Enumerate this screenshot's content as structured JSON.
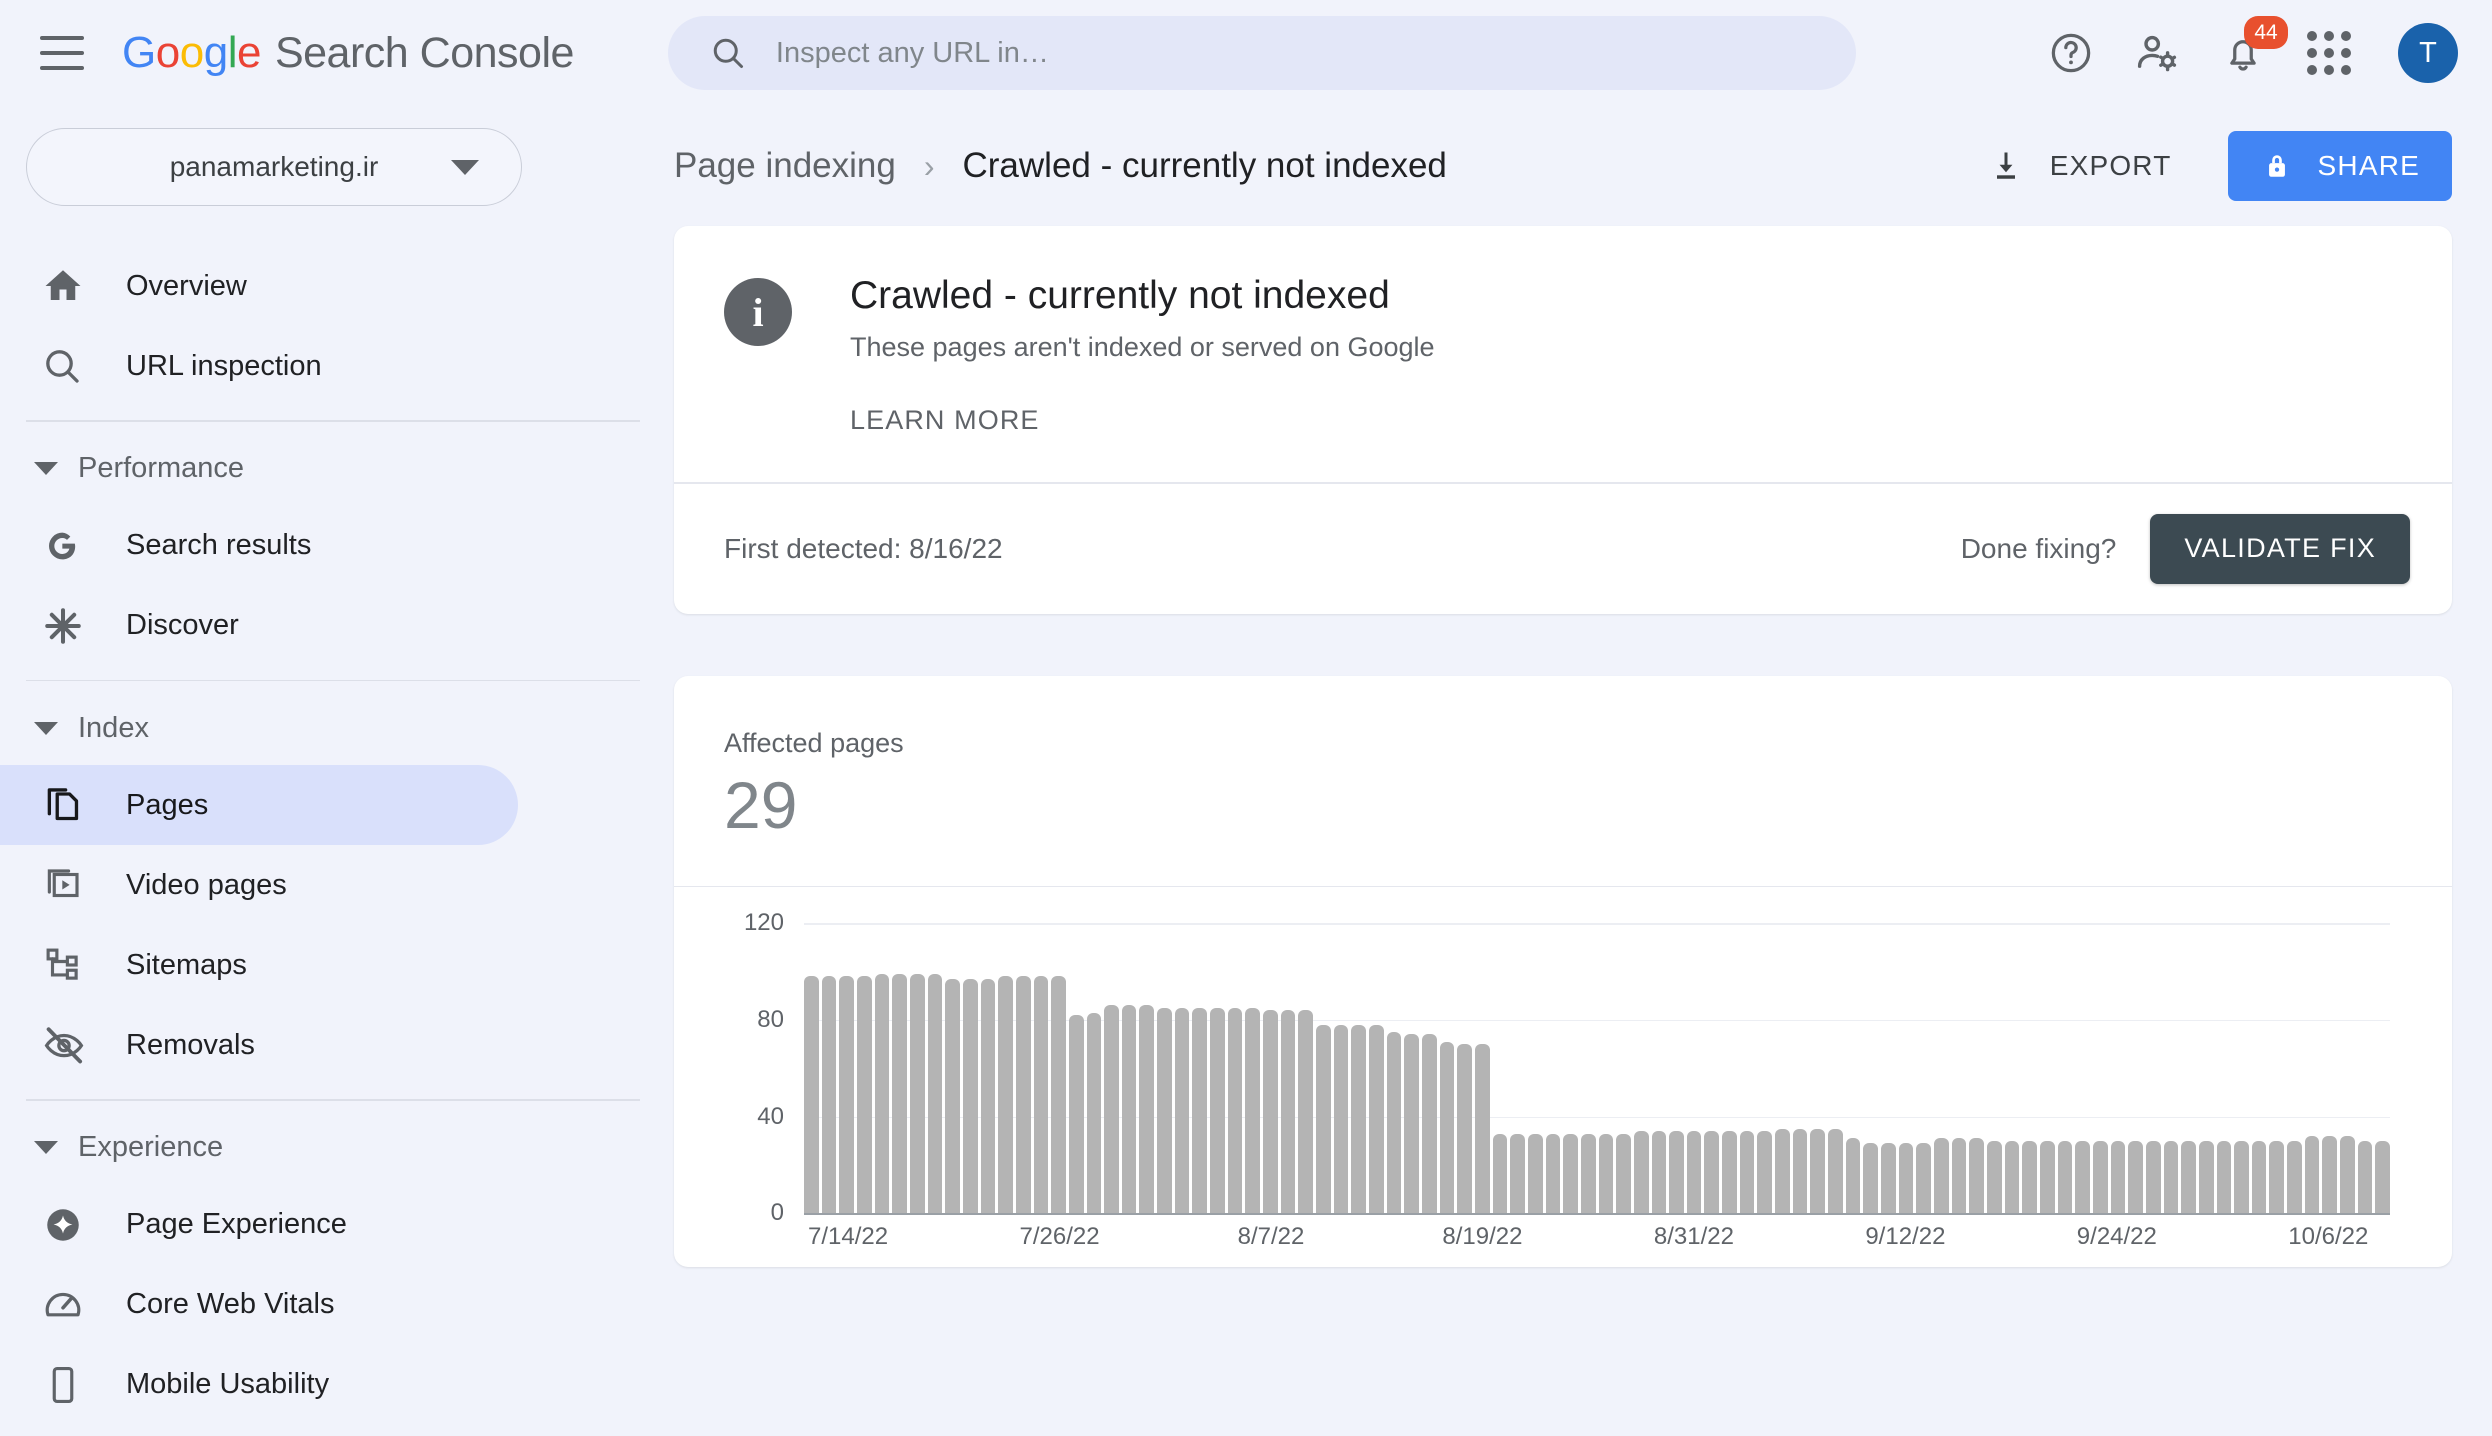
{
  "header": {
    "brand_google": "Google",
    "brand_rest": "Search Console",
    "search_placeholder": "Inspect any URL in…",
    "search_value": "",
    "notification_count": "44",
    "avatar_initial": "T"
  },
  "sidebar": {
    "property": "panamarketing.ir",
    "items": [
      {
        "label": "Overview",
        "icon": "home-icon"
      },
      {
        "label": "URL inspection",
        "icon": "search-icon"
      }
    ],
    "sections": [
      {
        "label": "Performance",
        "items": [
          {
            "label": "Search results",
            "icon": "google-g-icon"
          },
          {
            "label": "Discover",
            "icon": "discover-asterisk-icon"
          }
        ]
      },
      {
        "label": "Index",
        "items": [
          {
            "label": "Pages",
            "icon": "pages-copy-icon",
            "active": true
          },
          {
            "label": "Video pages",
            "icon": "video-pages-icon"
          },
          {
            "label": "Sitemaps",
            "icon": "sitemap-icon"
          },
          {
            "label": "Removals",
            "icon": "eye-off-icon"
          }
        ]
      },
      {
        "label": "Experience",
        "items": [
          {
            "label": "Page Experience",
            "icon": "page-experience-icon"
          },
          {
            "label": "Core Web Vitals",
            "icon": "speedometer-icon"
          },
          {
            "label": "Mobile Usability",
            "icon": "mobile-icon"
          }
        ]
      }
    ]
  },
  "main": {
    "breadcrumb_parent": "Page indexing",
    "breadcrumb_separator": "›",
    "breadcrumb_current": "Crawled - currently not indexed",
    "export_label": "EXPORT",
    "share_label": "SHARE",
    "info": {
      "title": "Crawled - currently not indexed",
      "subtitle": "These pages aren't indexed or served on Google",
      "learn_more": "LEARN MORE"
    },
    "fix": {
      "first_detected": "First detected: 8/16/22",
      "done_fixing": "Done fixing?",
      "validate_label": "VALIDATE FIX"
    },
    "affected": {
      "label": "Affected pages",
      "value": "29"
    }
  },
  "colors": {
    "accent_blue": "#4285f4",
    "badge_red": "#e8502e",
    "avatar_blue": "#1a62ab",
    "validate_dark": "#3c4a52",
    "bar_gray": "#b4b4b4",
    "active_nav": "#d9e0fb",
    "page_bg": "#f1f3fb"
  },
  "chart_data": {
    "type": "bar",
    "title": "Affected pages over time",
    "xlabel": "",
    "ylabel": "",
    "ylim": [
      0,
      120
    ],
    "yticks": [
      0,
      40,
      80,
      120
    ],
    "grid": true,
    "legend": false,
    "tick_labels": [
      "7/14/22",
      "7/26/22",
      "8/7/22",
      "8/19/22",
      "8/31/22",
      "9/12/22",
      "9/24/22",
      "10/6/22"
    ],
    "tick_indices": [
      2,
      14,
      26,
      38,
      50,
      62,
      74,
      86
    ],
    "x": [
      "7/12/22",
      "7/13/22",
      "7/14/22",
      "7/15/22",
      "7/16/22",
      "7/17/22",
      "7/18/22",
      "7/19/22",
      "7/20/22",
      "7/21/22",
      "7/22/22",
      "7/23/22",
      "7/24/22",
      "7/25/22",
      "7/26/22",
      "7/27/22",
      "7/28/22",
      "7/29/22",
      "7/30/22",
      "7/31/22",
      "8/1/22",
      "8/2/22",
      "8/3/22",
      "8/4/22",
      "8/5/22",
      "8/6/22",
      "8/7/22",
      "8/8/22",
      "8/9/22",
      "8/10/22",
      "8/11/22",
      "8/12/22",
      "8/13/22",
      "8/14/22",
      "8/15/22",
      "8/16/22",
      "8/17/22",
      "8/18/22",
      "8/19/22",
      "8/20/22",
      "8/21/22",
      "8/22/22",
      "8/23/22",
      "8/24/22",
      "8/25/22",
      "8/26/22",
      "8/27/22",
      "8/28/22",
      "8/29/22",
      "8/30/22",
      "8/31/22",
      "9/1/22",
      "9/2/22",
      "9/3/22",
      "9/4/22",
      "9/5/22",
      "9/6/22",
      "9/7/22",
      "9/8/22",
      "9/9/22",
      "9/10/22",
      "9/11/22",
      "9/12/22",
      "9/13/22",
      "9/14/22",
      "9/15/22",
      "9/16/22",
      "9/17/22",
      "9/18/22",
      "9/19/22",
      "9/20/22",
      "9/21/22",
      "9/22/22",
      "9/23/22",
      "9/24/22",
      "9/25/22",
      "9/26/22",
      "9/27/22",
      "9/28/22",
      "9/29/22",
      "9/30/22",
      "10/1/22",
      "10/2/22",
      "10/3/22",
      "10/4/22",
      "10/5/22",
      "10/6/22",
      "10/7/22",
      "10/8/22",
      "10/9/22"
    ],
    "values": [
      98,
      98,
      98,
      98,
      99,
      99,
      99,
      99,
      97,
      97,
      97,
      98,
      98,
      98,
      98,
      82,
      83,
      86,
      86,
      86,
      85,
      85,
      85,
      85,
      85,
      85,
      84,
      84,
      84,
      78,
      78,
      78,
      78,
      75,
      74,
      74,
      71,
      70,
      70,
      33,
      33,
      33,
      33,
      33,
      33,
      33,
      33,
      34,
      34,
      34,
      34,
      34,
      34,
      34,
      34,
      35,
      35,
      35,
      35,
      31,
      29,
      29,
      29,
      29,
      31,
      31,
      31,
      30,
      30,
      30,
      30,
      30,
      30,
      30,
      30,
      30,
      30,
      30,
      30,
      30,
      30,
      30,
      30,
      30,
      30,
      32,
      32,
      32,
      30,
      30
    ]
  }
}
